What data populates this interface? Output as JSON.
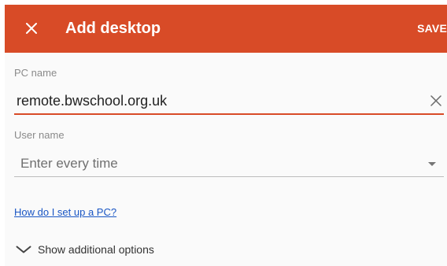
{
  "header": {
    "title": "Add desktop",
    "save_label": "SAVE",
    "close_icon": "close-icon",
    "background_color": "#d84b27"
  },
  "pc_name": {
    "label": "PC name",
    "value": "remote.bwschool.org.uk",
    "clear_icon": "close-icon",
    "accent_color": "#d84b27"
  },
  "user_name": {
    "label": "User name",
    "value": "Enter every time",
    "dropdown_icon": "dropdown-arrow-icon"
  },
  "help_link": "How do I set up a PC?",
  "additional_options": {
    "label": "Show additional options",
    "icon": "chevron-down-icon"
  }
}
